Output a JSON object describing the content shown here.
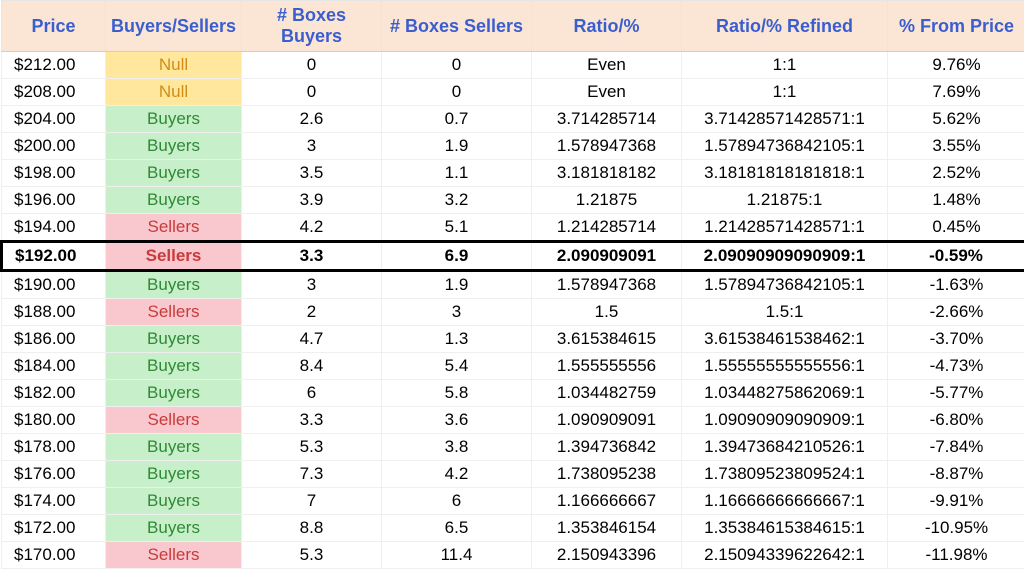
{
  "headers": {
    "price": "Price",
    "bs": "Buyers/Sellers",
    "boxb": "# Boxes Buyers",
    "boxs": "# Boxes Sellers",
    "ratio": "Ratio/%",
    "refined": "Ratio/% Refined",
    "pct": "% From Price"
  },
  "rows": [
    {
      "price": "$212.00",
      "bs": "Null",
      "bs_class": "bs-null",
      "boxb": "0",
      "boxs": "0",
      "ratio": "Even",
      "refined": "1:1",
      "pct": "9.76%",
      "highlight": false
    },
    {
      "price": "$208.00",
      "bs": "Null",
      "bs_class": "bs-null",
      "boxb": "0",
      "boxs": "0",
      "ratio": "Even",
      "refined": "1:1",
      "pct": "7.69%",
      "highlight": false
    },
    {
      "price": "$204.00",
      "bs": "Buyers",
      "bs_class": "bs-buyers",
      "boxb": "2.6",
      "boxs": "0.7",
      "ratio": "3.714285714",
      "refined": "3.71428571428571:1",
      "pct": "5.62%",
      "highlight": false
    },
    {
      "price": "$200.00",
      "bs": "Buyers",
      "bs_class": "bs-buyers",
      "boxb": "3",
      "boxs": "1.9",
      "ratio": "1.578947368",
      "refined": "1.57894736842105:1",
      "pct": "3.55%",
      "highlight": false
    },
    {
      "price": "$198.00",
      "bs": "Buyers",
      "bs_class": "bs-buyers",
      "boxb": "3.5",
      "boxs": "1.1",
      "ratio": "3.181818182",
      "refined": "3.18181818181818:1",
      "pct": "2.52%",
      "highlight": false
    },
    {
      "price": "$196.00",
      "bs": "Buyers",
      "bs_class": "bs-buyers",
      "boxb": "3.9",
      "boxs": "3.2",
      "ratio": "1.21875",
      "refined": "1.21875:1",
      "pct": "1.48%",
      "highlight": false
    },
    {
      "price": "$194.00",
      "bs": "Sellers",
      "bs_class": "bs-sellers",
      "boxb": "4.2",
      "boxs": "5.1",
      "ratio": "1.214285714",
      "refined": "1.21428571428571:1",
      "pct": "0.45%",
      "highlight": false
    },
    {
      "price": "$192.00",
      "bs": "Sellers",
      "bs_class": "bs-sellers",
      "boxb": "3.3",
      "boxs": "6.9",
      "ratio": "2.090909091",
      "refined": "2.09090909090909:1",
      "pct": "-0.59%",
      "highlight": true
    },
    {
      "price": "$190.00",
      "bs": "Buyers",
      "bs_class": "bs-buyers",
      "boxb": "3",
      "boxs": "1.9",
      "ratio": "1.578947368",
      "refined": "1.57894736842105:1",
      "pct": "-1.63%",
      "highlight": false
    },
    {
      "price": "$188.00",
      "bs": "Sellers",
      "bs_class": "bs-sellers",
      "boxb": "2",
      "boxs": "3",
      "ratio": "1.5",
      "refined": "1.5:1",
      "pct": "-2.66%",
      "highlight": false
    },
    {
      "price": "$186.00",
      "bs": "Buyers",
      "bs_class": "bs-buyers",
      "boxb": "4.7",
      "boxs": "1.3",
      "ratio": "3.615384615",
      "refined": "3.61538461538462:1",
      "pct": "-3.70%",
      "highlight": false
    },
    {
      "price": "$184.00",
      "bs": "Buyers",
      "bs_class": "bs-buyers",
      "boxb": "8.4",
      "boxs": "5.4",
      "ratio": "1.555555556",
      "refined": "1.55555555555556:1",
      "pct": "-4.73%",
      "highlight": false
    },
    {
      "price": "$182.00",
      "bs": "Buyers",
      "bs_class": "bs-buyers",
      "boxb": "6",
      "boxs": "5.8",
      "ratio": "1.034482759",
      "refined": "1.03448275862069:1",
      "pct": "-5.77%",
      "highlight": false
    },
    {
      "price": "$180.00",
      "bs": "Sellers",
      "bs_class": "bs-sellers",
      "boxb": "3.3",
      "boxs": "3.6",
      "ratio": "1.090909091",
      "refined": "1.09090909090909:1",
      "pct": "-6.80%",
      "highlight": false
    },
    {
      "price": "$178.00",
      "bs": "Buyers",
      "bs_class": "bs-buyers",
      "boxb": "5.3",
      "boxs": "3.8",
      "ratio": "1.394736842",
      "refined": "1.39473684210526:1",
      "pct": "-7.84%",
      "highlight": false
    },
    {
      "price": "$176.00",
      "bs": "Buyers",
      "bs_class": "bs-buyers",
      "boxb": "7.3",
      "boxs": "4.2",
      "ratio": "1.738095238",
      "refined": "1.73809523809524:1",
      "pct": "-8.87%",
      "highlight": false
    },
    {
      "price": "$174.00",
      "bs": "Buyers",
      "bs_class": "bs-buyers",
      "boxb": "7",
      "boxs": "6",
      "ratio": "1.166666667",
      "refined": "1.16666666666667:1",
      "pct": "-9.91%",
      "highlight": false
    },
    {
      "price": "$172.00",
      "bs": "Buyers",
      "bs_class": "bs-buyers",
      "boxb": "8.8",
      "boxs": "6.5",
      "ratio": "1.353846154",
      "refined": "1.35384615384615:1",
      "pct": "-10.95%",
      "highlight": false
    },
    {
      "price": "$170.00",
      "bs": "Sellers",
      "bs_class": "bs-sellers",
      "boxb": "5.3",
      "boxs": "11.4",
      "ratio": "2.150943396",
      "refined": "2.15094339622642:1",
      "pct": "-11.98%",
      "highlight": false
    }
  ]
}
